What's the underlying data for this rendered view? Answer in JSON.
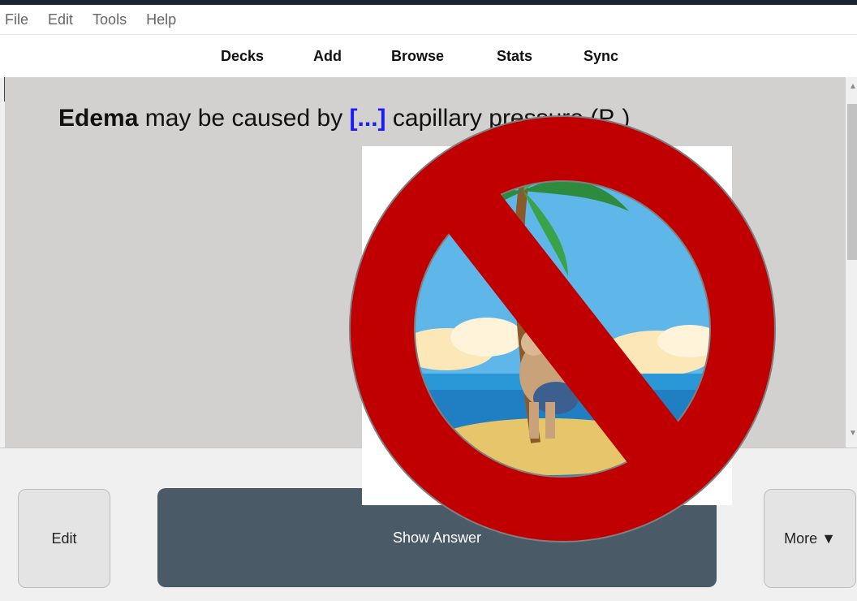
{
  "menu": {
    "items": [
      "File",
      "Edit",
      "Tools",
      "Help"
    ]
  },
  "toolbar": {
    "decks": "Decks",
    "add": "Add",
    "browse": "Browse",
    "stats": "Stats",
    "sync": "Sync"
  },
  "card": {
    "term": "Edema",
    "text_before": " may be caused by ",
    "cloze": "[...]",
    "text_after": " capillary pressure (P",
    "subscript": "c",
    "close_paren": ")"
  },
  "buttons": {
    "edit": "Edit",
    "show_answer": "Show Answer",
    "more": "More ▼"
  },
  "overlay": {
    "icon": "prohibition-sign-over-castaway-island-icon",
    "colors": {
      "sign": "#c00000",
      "sea": "#1f7fc2",
      "sky": "#5fb6e8",
      "sand": "#e7c56a"
    }
  }
}
